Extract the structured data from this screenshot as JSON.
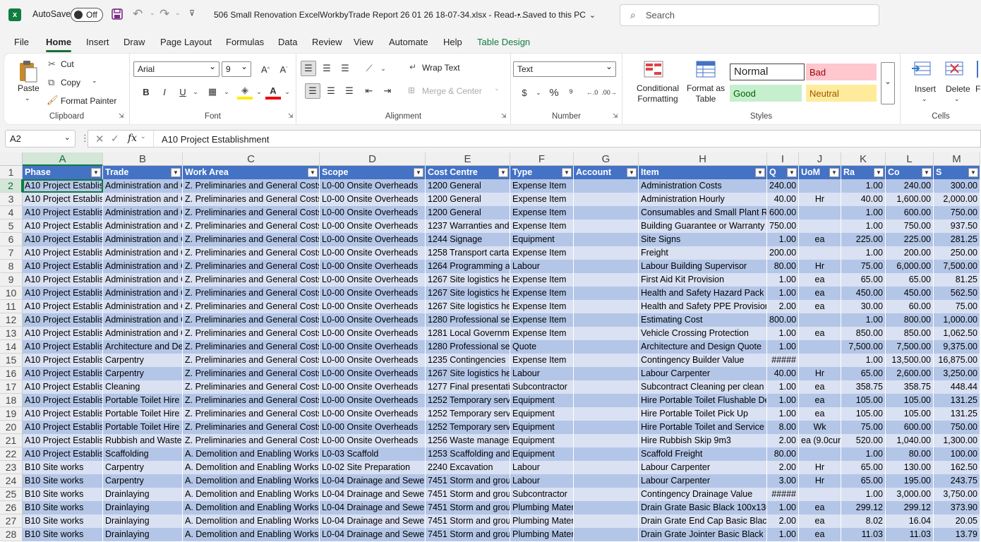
{
  "titlebar": {
    "autosave_label": "AutoSave",
    "autosave_state": "Off",
    "filename": "506 Small Renovation ExcelWorkbyTrade Report 26 01 26 18-07-34.xlsx  -  Read-...",
    "saved_status": "• Saved to this PC",
    "search_placeholder": "Search"
  },
  "menu": [
    "File",
    "Home",
    "Insert",
    "Draw",
    "Page Layout",
    "Formulas",
    "Data",
    "Review",
    "View",
    "Automate",
    "Help",
    "Table Design"
  ],
  "ribbon": {
    "clipboard": {
      "paste": "Paste",
      "cut": "Cut",
      "copy": "Copy",
      "format_painter": "Format Painter",
      "label": "Clipboard"
    },
    "font": {
      "name": "Arial",
      "size": "9",
      "label": "Font"
    },
    "alignment": {
      "wrap_text": "Wrap Text",
      "merge_center": "Merge & Center",
      "label": "Alignment"
    },
    "number": {
      "format": "Text",
      "label": "Number"
    },
    "styles": {
      "conditional_formatting": "Conditional Formatting",
      "format_as_table": "Format as Table",
      "normal": "Normal",
      "bad": "Bad",
      "good": "Good",
      "neutral": "Neutral",
      "label": "Styles"
    },
    "cells": {
      "insert": "Insert",
      "delete": "Delete",
      "format": "For",
      "label": "Cells"
    }
  },
  "formula_bar": {
    "name_box": "A2",
    "fx": "fx",
    "content": "A10 Project Establishment"
  },
  "colors": {
    "header_blue": "#4472c4",
    "band_dark": "#b4c6e7",
    "band_light": "#d9e1f2",
    "excel_green": "#107c41"
  },
  "columns": [
    {
      "letter": "A",
      "header": "Phase"
    },
    {
      "letter": "B",
      "header": "Trade"
    },
    {
      "letter": "C",
      "header": "Work Area"
    },
    {
      "letter": "D",
      "header": "Scope"
    },
    {
      "letter": "E",
      "header": "Cost Centre"
    },
    {
      "letter": "F",
      "header": "Type"
    },
    {
      "letter": "G",
      "header": "Account"
    },
    {
      "letter": "H",
      "header": "Item"
    },
    {
      "letter": "I",
      "header": "Q"
    },
    {
      "letter": "J",
      "header": "UoM"
    },
    {
      "letter": "K",
      "header": "Ra"
    },
    {
      "letter": "L",
      "header": "Co"
    },
    {
      "letter": "M",
      "header": "S"
    }
  ],
  "rows": [
    {
      "n": "2",
      "c": [
        "A10 Project Establis",
        "Administration and C",
        "Z. Preliminaries and General Costs",
        "L0-00 Onsite Overheads",
        "1200 General",
        "Expense Item",
        "",
        "Administration Costs",
        "240.00",
        "",
        "1.00",
        "240.00",
        "300.00"
      ]
    },
    {
      "n": "3",
      "c": [
        "A10 Project Establis",
        "Administration and C",
        "Z. Preliminaries and General Costs",
        "L0-00 Onsite Overheads",
        "1200 General",
        "Expense Item",
        "",
        "Administration Hourly",
        "40.00",
        "Hr",
        "40.00",
        "1,600.00",
        "2,000.00"
      ]
    },
    {
      "n": "4",
      "c": [
        "A10 Project Establis",
        "Administration and C",
        "Z. Preliminaries and General Costs",
        "L0-00 Onsite Overheads",
        "1200 General",
        "Expense Item",
        "",
        "Consumables and Small Plant R",
        "600.00",
        "",
        "1.00",
        "600.00",
        "750.00"
      ]
    },
    {
      "n": "5",
      "c": [
        "A10 Project Establis",
        "Administration and C",
        "Z. Preliminaries and General Costs",
        "L0-00 Onsite Overheads",
        "1237 Warranties and",
        "Expense Item",
        "",
        "Building Guarantee or Warranty",
        "750.00",
        "",
        "1.00",
        "750.00",
        "937.50"
      ]
    },
    {
      "n": "6",
      "c": [
        "A10 Project Establis",
        "Administration and C",
        "Z. Preliminaries and General Costs",
        "L0-00 Onsite Overheads",
        "1244 Signage",
        "Equipment",
        "",
        "Site Signs",
        "1.00",
        "ea",
        "225.00",
        "225.00",
        "281.25"
      ]
    },
    {
      "n": "7",
      "c": [
        "A10 Project Establis",
        "Administration and C",
        "Z. Preliminaries and General Costs",
        "L0-00 Onsite Overheads",
        "1258 Transport cartag",
        "Expense Item",
        "",
        "Freight",
        "200.00",
        "",
        "1.00",
        "200.00",
        "250.00"
      ]
    },
    {
      "n": "8",
      "c": [
        "A10 Project Establis",
        "Administration and C",
        "Z. Preliminaries and General Costs",
        "L0-00 Onsite Overheads",
        "1264 Programming a",
        "Labour",
        "",
        "Labour Building Supervisor",
        "80.00",
        "Hr",
        "75.00",
        "6,000.00",
        "7,500.00"
      ]
    },
    {
      "n": "9",
      "c": [
        "A10 Project Establis",
        "Administration and C",
        "Z. Preliminaries and General Costs",
        "L0-00 Onsite Overheads",
        "1267 Site logistics he",
        "Expense Item",
        "",
        "First Aid Kit Provision",
        "1.00",
        "ea",
        "65.00",
        "65.00",
        "81.25"
      ]
    },
    {
      "n": "10",
      "c": [
        "A10 Project Establis",
        "Administration and C",
        "Z. Preliminaries and General Costs",
        "L0-00 Onsite Overheads",
        "1267 Site logistics he",
        "Expense Item",
        "",
        "Health and Safety Hazard Pack",
        "1.00",
        "ea",
        "450.00",
        "450.00",
        "562.50"
      ]
    },
    {
      "n": "11",
      "c": [
        "A10 Project Establis",
        "Administration and C",
        "Z. Preliminaries and General Costs",
        "L0-00 Onsite Overheads",
        "1267 Site logistics he",
        "Expense Item",
        "",
        "Health and Safety PPE Provision",
        "2.00",
        "ea",
        "30.00",
        "60.00",
        "75.00"
      ]
    },
    {
      "n": "12",
      "c": [
        "A10 Project Establis",
        "Administration and C",
        "Z. Preliminaries and General Costs",
        "L0-00 Onsite Overheads",
        "1280 Professional se",
        "Expense Item",
        "",
        "Estimating Cost",
        "800.00",
        "",
        "1.00",
        "800.00",
        "1,000.00"
      ]
    },
    {
      "n": "13",
      "c": [
        "A10 Project Establis",
        "Administration and C",
        "Z. Preliminaries and General Costs",
        "L0-00 Onsite Overheads",
        "1281 Local Governme",
        "Expense Item",
        "",
        "Vehicle Crossing Protection",
        "1.00",
        "ea",
        "850.00",
        "850.00",
        "1,062.50"
      ]
    },
    {
      "n": "14",
      "c": [
        "A10 Project Establis",
        "Architecture and Des",
        "Z. Preliminaries and General Costs",
        "L0-00 Onsite Overheads",
        "1280 Professional se",
        "Quote",
        "",
        "Architecture and Design Quote",
        "1.00",
        "",
        "7,500.00",
        "7,500.00",
        "9,375.00"
      ]
    },
    {
      "n": "15",
      "c": [
        "A10 Project Establis",
        "Carpentry",
        "Z. Preliminaries and General Costs",
        "L0-00 Onsite Overheads",
        "1235 Contingencies",
        "Expense Item",
        "",
        "Contingency Builder Value",
        "#####",
        "",
        "1.00",
        "13,500.00",
        "16,875.00"
      ]
    },
    {
      "n": "16",
      "c": [
        "A10 Project Establis",
        "Carpentry",
        "Z. Preliminaries and General Costs",
        "L0-00 Onsite Overheads",
        "1267 Site logistics he",
        "Labour",
        "",
        "Labour Carpenter",
        "40.00",
        "Hr",
        "65.00",
        "2,600.00",
        "3,250.00"
      ]
    },
    {
      "n": "17",
      "c": [
        "A10 Project Establis",
        "Cleaning",
        "Z. Preliminaries and General Costs",
        "L0-00 Onsite Overheads",
        "1277 Final presentati",
        "Subcontractor",
        "",
        "Subcontract Cleaning per clean",
        "1.00",
        "ea",
        "358.75",
        "358.75",
        "448.44"
      ]
    },
    {
      "n": "18",
      "c": [
        "A10 Project Establis",
        "Portable Toilet Hire",
        "Z. Preliminaries and General Costs",
        "L0-00 Onsite Overheads",
        "1252 Temporary servi",
        "Equipment",
        "",
        "Hire Portable Toilet Flushable De",
        "1.00",
        "ea",
        "105.00",
        "105.00",
        "131.25"
      ]
    },
    {
      "n": "19",
      "c": [
        "A10 Project Establis",
        "Portable Toilet Hire",
        "Z. Preliminaries and General Costs",
        "L0-00 Onsite Overheads",
        "1252 Temporary servi",
        "Equipment",
        "",
        "Hire Portable Toilet Pick Up",
        "1.00",
        "ea",
        "105.00",
        "105.00",
        "131.25"
      ]
    },
    {
      "n": "20",
      "c": [
        "A10 Project Establis",
        "Portable Toilet Hire",
        "Z. Preliminaries and General Costs",
        "L0-00 Onsite Overheads",
        "1252 Temporary servi",
        "Equipment",
        "",
        "Hire Portable Toilet and Service W",
        "8.00",
        "Wk",
        "75.00",
        "600.00",
        "750.00"
      ]
    },
    {
      "n": "21",
      "c": [
        "A10 Project Establis",
        "Rubbish and Waste",
        "Z. Preliminaries and General Costs",
        "L0-00 Onsite Overheads",
        "1256 Waste manager",
        "Equipment",
        "",
        "Hire Rubbish Skip 9m3",
        "2.00",
        "ea (9.0cum",
        "520.00",
        "1,040.00",
        "1,300.00"
      ]
    },
    {
      "n": "22",
      "c": [
        "A10 Project Establis",
        "Scaffolding",
        "A. Demolition and Enabling Works",
        "L0-03 Scaffold",
        "1253 Scaffolding and",
        "Equipment",
        "",
        "Scaffold Freight",
        "80.00",
        "",
        "1.00",
        "80.00",
        "100.00"
      ]
    },
    {
      "n": "23",
      "c": [
        "B10 Site works",
        "Carpentry",
        "A. Demolition and Enabling Works",
        "L0-02 Site Preparation",
        "2240 Excavation",
        "Labour",
        "",
        "Labour Carpenter",
        "2.00",
        "Hr",
        "65.00",
        "130.00",
        "162.50"
      ]
    },
    {
      "n": "24",
      "c": [
        "B10 Site works",
        "Carpentry",
        "A. Demolition and Enabling Works",
        "L0-04 Drainage and Sewer",
        "7451 Storm and grou",
        "Labour",
        "",
        "Labour Carpenter",
        "3.00",
        "Hr",
        "65.00",
        "195.00",
        "243.75"
      ]
    },
    {
      "n": "25",
      "c": [
        "B10 Site works",
        "Drainlaying",
        "A. Demolition and Enabling Works",
        "L0-04 Drainage and Sewer",
        "7451 Storm and grou",
        "Subcontractor",
        "",
        "Contingency Drainage Value",
        "#####",
        "",
        "1.00",
        "3,000.00",
        "3,750.00"
      ]
    },
    {
      "n": "26",
      "c": [
        "B10 Site works",
        "Drainlaying",
        "A. Demolition and Enabling Works",
        "L0-04 Drainage and Sewer",
        "7451 Storm and grou",
        "Plumbing Materi",
        "",
        "Drain Grate Basic Black 100x130",
        "1.00",
        "ea",
        "299.12",
        "299.12",
        "373.90"
      ]
    },
    {
      "n": "27",
      "c": [
        "B10 Site works",
        "Drainlaying",
        "A. Demolition and Enabling Works",
        "L0-04 Drainage and Sewer",
        "7451 Storm and grou",
        "Plumbing Materi",
        "",
        "Drain Grate End Cap Basic Black",
        "2.00",
        "ea",
        "8.02",
        "16.04",
        "20.05"
      ]
    },
    {
      "n": "28",
      "c": [
        "B10 Site works",
        "Drainlaying",
        "A. Demolition and Enabling Works",
        "L0-04 Drainage and Sewer",
        "7451 Storm and grou",
        "Plumbing Materi",
        "",
        "Drain Grate Jointer Basic Black 7",
        "1.00",
        "ea",
        "11.03",
        "11.03",
        "13.79"
      ]
    }
  ]
}
